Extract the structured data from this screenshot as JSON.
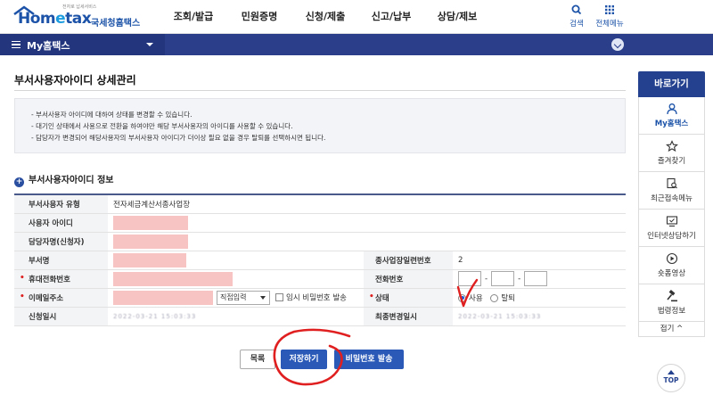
{
  "header": {
    "logo_brand_a": "Hom",
    "logo_brand_e": "e",
    "logo_brand_b": "tax",
    "logo_sub": "국세청홈택스",
    "logo_tiny": "전자로 납세서비스",
    "nav": [
      "조회/발급",
      "민원증명",
      "신청/제출",
      "신고/납부",
      "상담/제보"
    ],
    "search_label": "검색",
    "allmenu_label": "전체메뉴"
  },
  "menubar": {
    "title": "My홈택스"
  },
  "page": {
    "title": "부서사용자아이디 상세관리",
    "notices": [
      "- 부서사용자 아이디에 대하여 상태를 변경할 수 있습니다.",
      "- 대기인 상태에서 사용으로 전환을 하여야만 해당 부서사용자의 아이디를 사용할 수 있습니다.",
      "- 담당자가 변경되어 해당사용자의 부서사용자 아이디가 더이상 필요 없을 경우 탈퇴를 선택하시면 됩니다."
    ],
    "section_title": "부서사용자아이디 정보"
  },
  "form": {
    "type_label": "부서사용자 유형",
    "type_value": "전자세금계산서종사업장",
    "userid_label": "사용자 아이디",
    "manager_label": "담당자명(신청자)",
    "dept_label": "부서명",
    "subbiz_label": "종사업장일련번호",
    "subbiz_value": "2",
    "mobile_label": "휴대전화번호",
    "phone_label": "전화번호",
    "email_label": "이메일주소",
    "email_select": "직접입력",
    "temp_pw_label": "임시 비밀번호 발송",
    "status_label": "상태",
    "status_options": [
      "사용",
      "탈퇴"
    ],
    "apply_label": "신청일시",
    "apply_value": "2022-03-21 15:03:33",
    "changed_label": "최종변경일시",
    "changed_value": "2022-03-21 15:03:33"
  },
  "buttons": {
    "list": "목록",
    "save": "저장하기",
    "password": "비밀번호 발송"
  },
  "quick": {
    "title": "바로가기",
    "items": [
      "My홈택스",
      "즐겨찾기",
      "최근접속메뉴",
      "인터넷상담하기",
      "숏폼영상",
      "법령정보"
    ],
    "fold": "접기 ^",
    "top": "TOP"
  },
  "colors": {
    "primary": "#2a59b8",
    "navbar": "#2a3e8a",
    "mask": "#f7c3c3",
    "annotation": "#e02020"
  }
}
